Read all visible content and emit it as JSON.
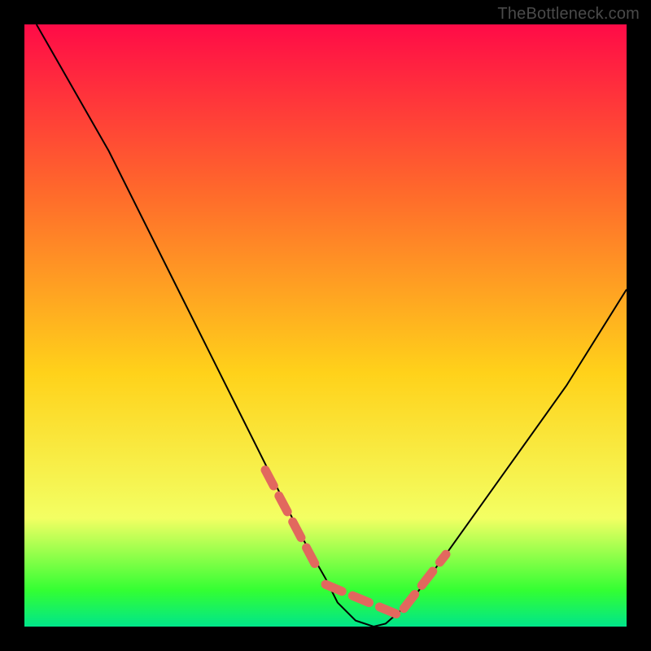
{
  "watermark": "TheBottleneck.com",
  "colors": {
    "bg": "#000000",
    "curve": "#000000",
    "dash": "#e2685e",
    "grad_top": "#ff0b47",
    "grad_upper": "#ff6a2b",
    "grad_mid": "#ffd21a",
    "grad_lower": "#f3ff63",
    "grad_green": "#33ff33",
    "grad_bottom": "#00e58a"
  },
  "chart_data": {
    "type": "line",
    "title": "",
    "xlabel": "",
    "ylabel": "",
    "xlim": [
      0,
      100
    ],
    "ylim": [
      0,
      100
    ],
    "curve": {
      "name": "bottleneck-curve",
      "x": [
        2,
        6,
        10,
        14,
        18,
        22,
        26,
        30,
        34,
        38,
        42,
        46,
        50,
        52,
        55,
        58,
        60,
        64,
        70,
        80,
        90,
        100
      ],
      "y": [
        100,
        93,
        86,
        79,
        71,
        63,
        55,
        47,
        39,
        31,
        23,
        15,
        8,
        4,
        1,
        0,
        0.5,
        4,
        12,
        26,
        40,
        56
      ]
    },
    "dashed_segments": [
      {
        "x": [
          40,
          49
        ],
        "y": [
          26,
          9
        ]
      },
      {
        "x": [
          50,
          62
        ],
        "y": [
          7,
          2
        ]
      },
      {
        "x": [
          63,
          70
        ],
        "y": [
          3,
          12
        ]
      }
    ],
    "gradient_stops": [
      {
        "offset": 0,
        "color": "#ff0b47"
      },
      {
        "offset": 28,
        "color": "#ff6a2b"
      },
      {
        "offset": 58,
        "color": "#ffd21a"
      },
      {
        "offset": 82,
        "color": "#f3ff63"
      },
      {
        "offset": 94,
        "color": "#33ff33"
      },
      {
        "offset": 100,
        "color": "#00e58a"
      }
    ]
  }
}
